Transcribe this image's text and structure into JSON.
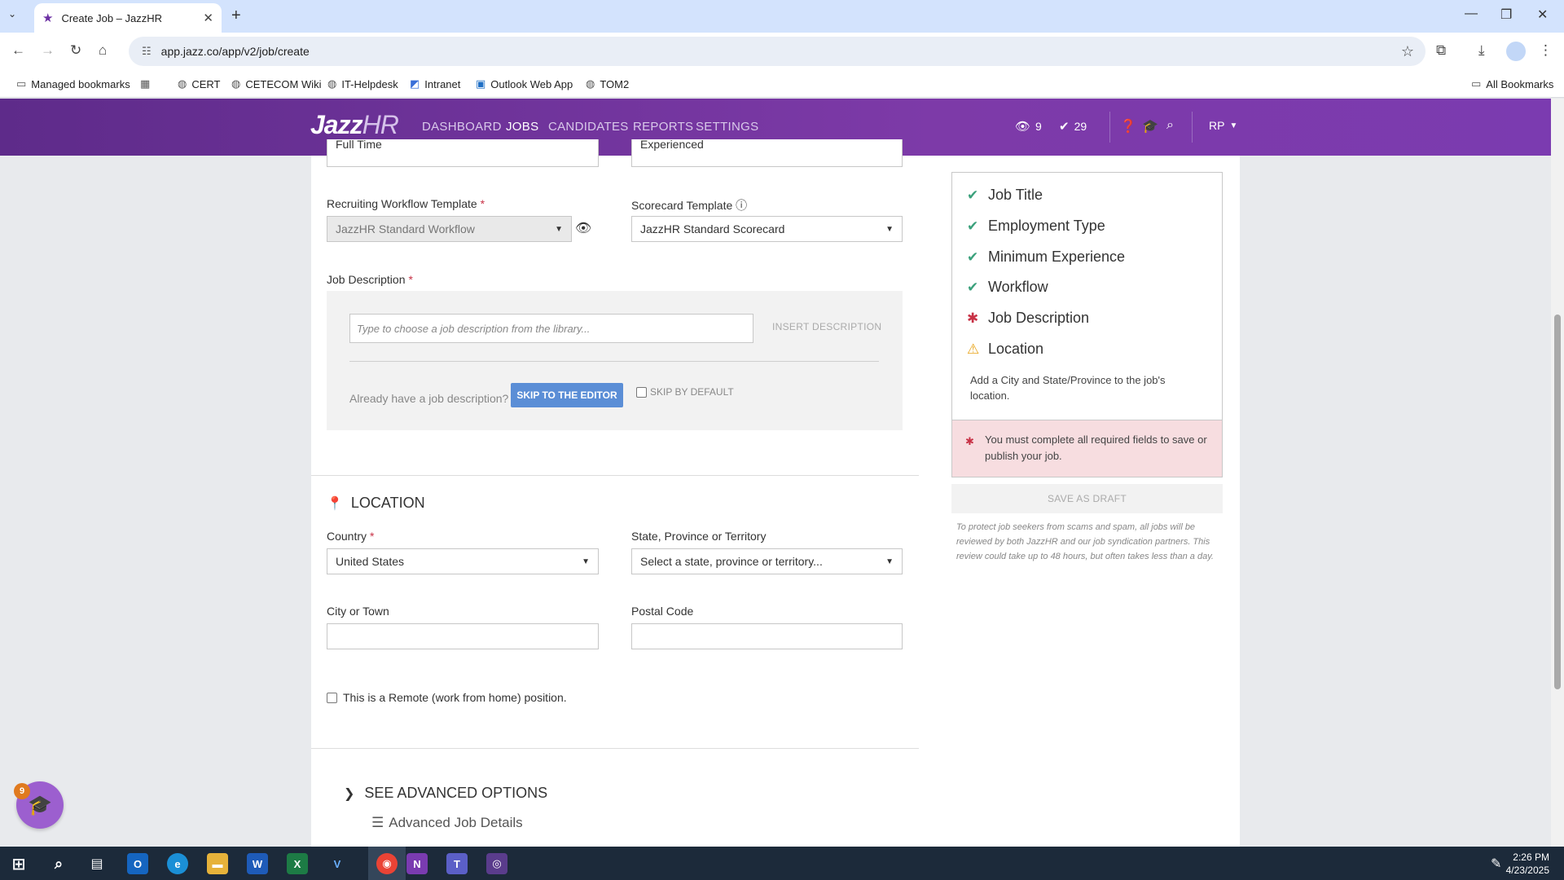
{
  "browser": {
    "tab_title": "Create Job – JazzHR",
    "url": "app.jazz.co/app/v2/job/create",
    "bookmarks": [
      "Managed bookmarks",
      "CERT",
      "CETECOM Wiki",
      "IT-Helpdesk",
      "Intranet",
      "Outlook Web App",
      "TOM2"
    ],
    "all_bookmarks": "All Bookmarks"
  },
  "nav": {
    "logo_main": "Jazz",
    "logo_hr": "HR",
    "links": [
      "DASHBOARD",
      "JOBS",
      "CANDIDATES",
      "REPORTS",
      "SETTINGS"
    ],
    "views_count": "9",
    "tasks_count": "29",
    "user_initials": "RP"
  },
  "form": {
    "employment_type_value": "Full Time",
    "experience_value": "Experienced",
    "workflow_label": "Recruiting Workflow Template",
    "workflow_value": "JazzHR Standard Workflow",
    "scorecard_label": "Scorecard Template",
    "scorecard_value": "JazzHR Standard Scorecard",
    "description_label": "Job Description",
    "description_placeholder": "Type to choose a job description from the library...",
    "insert_description": "INSERT DESCRIPTION",
    "already_have": "Already have a job description?",
    "skip_editor": "SKIP TO THE EDITOR",
    "skip_default": "SKIP BY DEFAULT",
    "required_mark": "*"
  },
  "location": {
    "title": "LOCATION",
    "country_label": "Country",
    "country_value": "United States",
    "state_label": "State, Province or Territory",
    "state_placeholder": "Select a state, province or territory...",
    "city_label": "City or Town",
    "city_value": "",
    "postal_label": "Postal Code",
    "postal_value": "",
    "remote_label": "This is a Remote (work from home) position."
  },
  "advanced": {
    "title": "SEE ADVANCED OPTIONS",
    "job_details": "Advanced Job Details"
  },
  "sidebar": {
    "checklist": [
      {
        "label": "Job Title",
        "status": "ok"
      },
      {
        "label": "Employment Type",
        "status": "ok"
      },
      {
        "label": "Minimum Experience",
        "status": "ok"
      },
      {
        "label": "Workflow",
        "status": "ok"
      },
      {
        "label": "Job Description",
        "status": "error"
      },
      {
        "label": "Location",
        "status": "warning"
      }
    ],
    "location_hint": "Add a City and State/Province to the job's location.",
    "alert": "You must complete all required fields to save or publish your job.",
    "save_draft": "SAVE AS DRAFT",
    "protect_note": "To protect job seekers from scams and spam, all jobs will be reviewed by both JazzHR and our job syndication partners. This review could take up to 48 hours, but often takes less than a day."
  },
  "help": {
    "badge": "9"
  },
  "taskbar": {
    "time": "2:26 PM",
    "date": "4/23/2025"
  },
  "colors": {
    "brand_purple": "#6b2fa3",
    "check_green": "#3ba17c",
    "required_red": "#c83246",
    "warning_yellow": "#e8a317"
  }
}
